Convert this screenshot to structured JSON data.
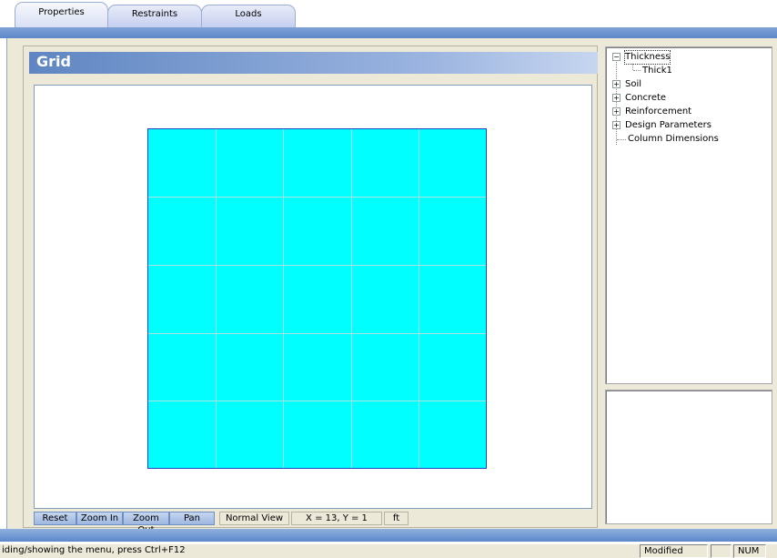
{
  "tabs": [
    {
      "label": "Properties",
      "active": true
    },
    {
      "label": "Restraints",
      "active": false
    },
    {
      "label": "Loads",
      "active": false
    }
  ],
  "grid": {
    "title": "Grid",
    "plate_color": "#00ffff",
    "plate_border_color": "#1c43c4",
    "columns": 5,
    "rows": 5
  },
  "view_toolbar": {
    "reset_label": "Reset",
    "zoom_in_label": "Zoom In",
    "zoom_out_label": "Zoom Out",
    "pan_label": "Pan",
    "view_mode": "Normal View",
    "coordinates": "X = 13, Y = 1",
    "units": "ft"
  },
  "tree": {
    "items": [
      {
        "label": "Thickness",
        "expanded": true,
        "selected": true
      },
      {
        "label": "Thick1"
      },
      {
        "label": "Soil",
        "expanded": false
      },
      {
        "label": "Concrete",
        "expanded": false
      },
      {
        "label": "Reinforcement",
        "expanded": false
      },
      {
        "label": "Design Parameters",
        "expanded": false
      },
      {
        "label": "Column Dimensions"
      }
    ],
    "expand_glyph": "+",
    "collapse_glyph": "−"
  },
  "status_bar": {
    "message": "iding/showing the menu, press Ctrl+F12",
    "state": "Modified",
    "num": "NUM"
  }
}
